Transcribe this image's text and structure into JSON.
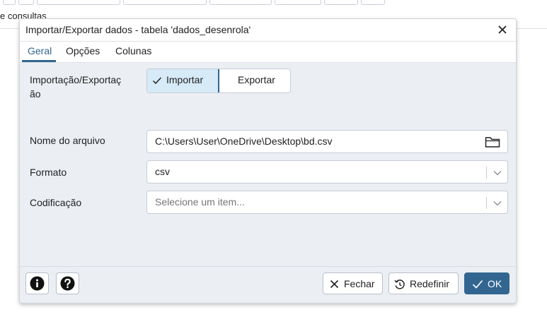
{
  "background": {
    "partial_text": "e consultas"
  },
  "dialog": {
    "title": "Importar/Exportar dados - tabela 'dados_desenrola'",
    "tabs": [
      {
        "label": "Geral",
        "active": true
      },
      {
        "label": "Opções",
        "active": false
      },
      {
        "label": "Colunas",
        "active": false
      }
    ],
    "fields": {
      "import_export": {
        "label": "Importação/Exportação",
        "label_line1": "Importação/Exportaç",
        "label_line2": "ão",
        "options": [
          "Importar",
          "Exportar"
        ],
        "selected": "Importar"
      },
      "filename": {
        "label": "Nome do arquivo",
        "value": "C:\\Users\\User\\OneDrive\\Desktop\\bd.csv"
      },
      "format": {
        "label": "Formato",
        "value": "csv"
      },
      "encoding": {
        "label": "Codificação",
        "placeholder": "Selecione um item..."
      }
    },
    "footer": {
      "close_label": "Fechar",
      "reset_label": "Redefinir",
      "ok_label": "OK"
    },
    "colors": {
      "accent": "#326690",
      "selected_bg": "#d6eaf7",
      "body_bg": "#ebeef3"
    }
  },
  "icons": [
    "close-icon",
    "check-icon",
    "folder-icon",
    "chevron-down-icon",
    "info-icon",
    "help-icon",
    "reset-icon"
  ]
}
